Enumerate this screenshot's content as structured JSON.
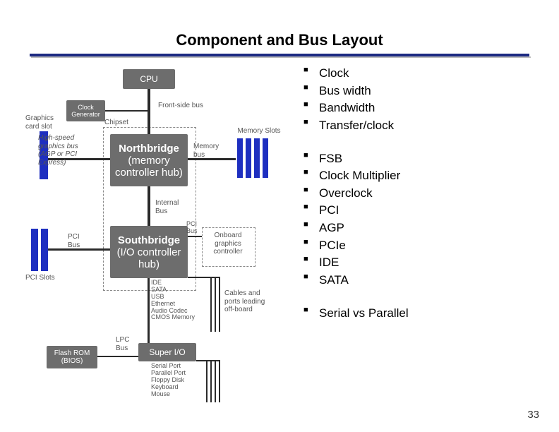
{
  "title": "Component and Bus Layout",
  "page_number": "33",
  "bullets": {
    "group1": [
      "Clock",
      "Bus width",
      "Bandwidth",
      "Transfer/clock"
    ],
    "group2": [
      "FSB",
      "Clock Multiplier",
      "Overclock",
      "PCI",
      "AGP",
      "PCIe",
      "IDE",
      "SATA"
    ],
    "group3": [
      "Serial vs Parallel"
    ]
  },
  "diagram": {
    "cpu": "CPU",
    "clockgen": "Clock\nGenerator",
    "northbridge": "Northbridge",
    "northbridge_sub": "(memory\ncontroller hub)",
    "southbridge": "Southbridge",
    "southbridge_sub": "(I/O controller\nhub)",
    "superio": "Super I/O",
    "flashrom": "Flash ROM\n(BIOS)",
    "onboard_gfx": "Onboard\ngraphics\ncontroller",
    "labels": {
      "gfx_slot": "Graphics\ncard slot",
      "hs_gfx": "High-speed\ngraphics bus\n(AGP or PCI\nExpress)",
      "fsb": "Front-side\nbus",
      "chipset": "Chipset",
      "mem_slots": "Memory Slots",
      "mem_bus": "Memory\nbus",
      "internal_bus": "Internal\nBus",
      "pci_bus": "PCI\nBus",
      "pci_slots": "PCI Slots",
      "sb_ports": "IDE\nSATA\nUSB\nEthernet\nAudio Codec\nCMOS Memory",
      "cables": "Cables and\nports leading\noff-board",
      "lpc_bus": "LPC\nBus",
      "sio_ports": "Serial Port\nParallel Port\nFloppy Disk\nKeyboard\nMouse"
    }
  }
}
